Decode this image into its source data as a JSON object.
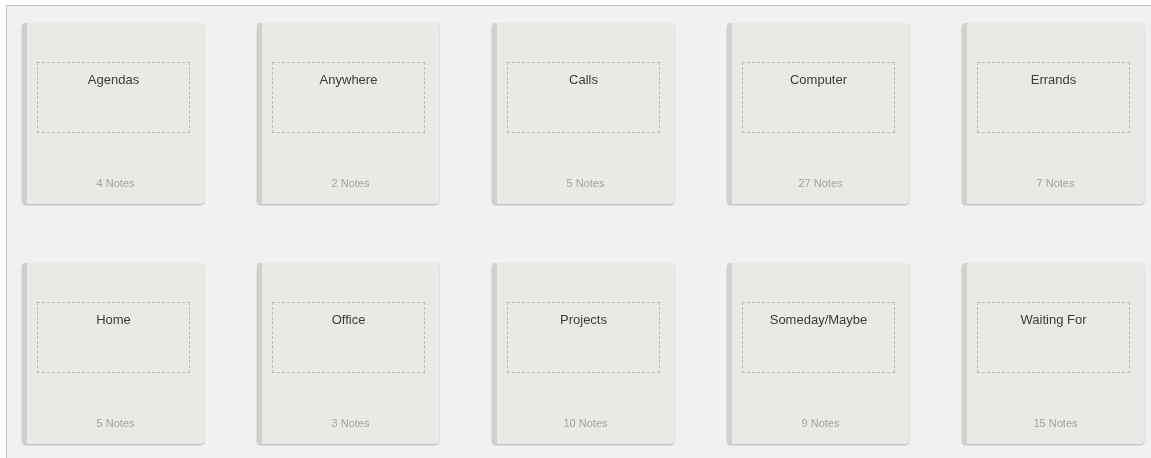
{
  "notebooks": [
    {
      "title": "Agendas",
      "count": "4 Notes"
    },
    {
      "title": "Anywhere",
      "count": "2 Notes"
    },
    {
      "title": "Calls",
      "count": "5 Notes"
    },
    {
      "title": "Computer",
      "count": "27 Notes"
    },
    {
      "title": "Errands",
      "count": "7 Notes"
    },
    {
      "title": "Home",
      "count": "5 Notes"
    },
    {
      "title": "Office",
      "count": "3 Notes"
    },
    {
      "title": "Projects",
      "count": "10 Notes"
    },
    {
      "title": "Someday/Maybe",
      "count": "9 Notes"
    },
    {
      "title": "Waiting For",
      "count": "15 Notes"
    }
  ]
}
